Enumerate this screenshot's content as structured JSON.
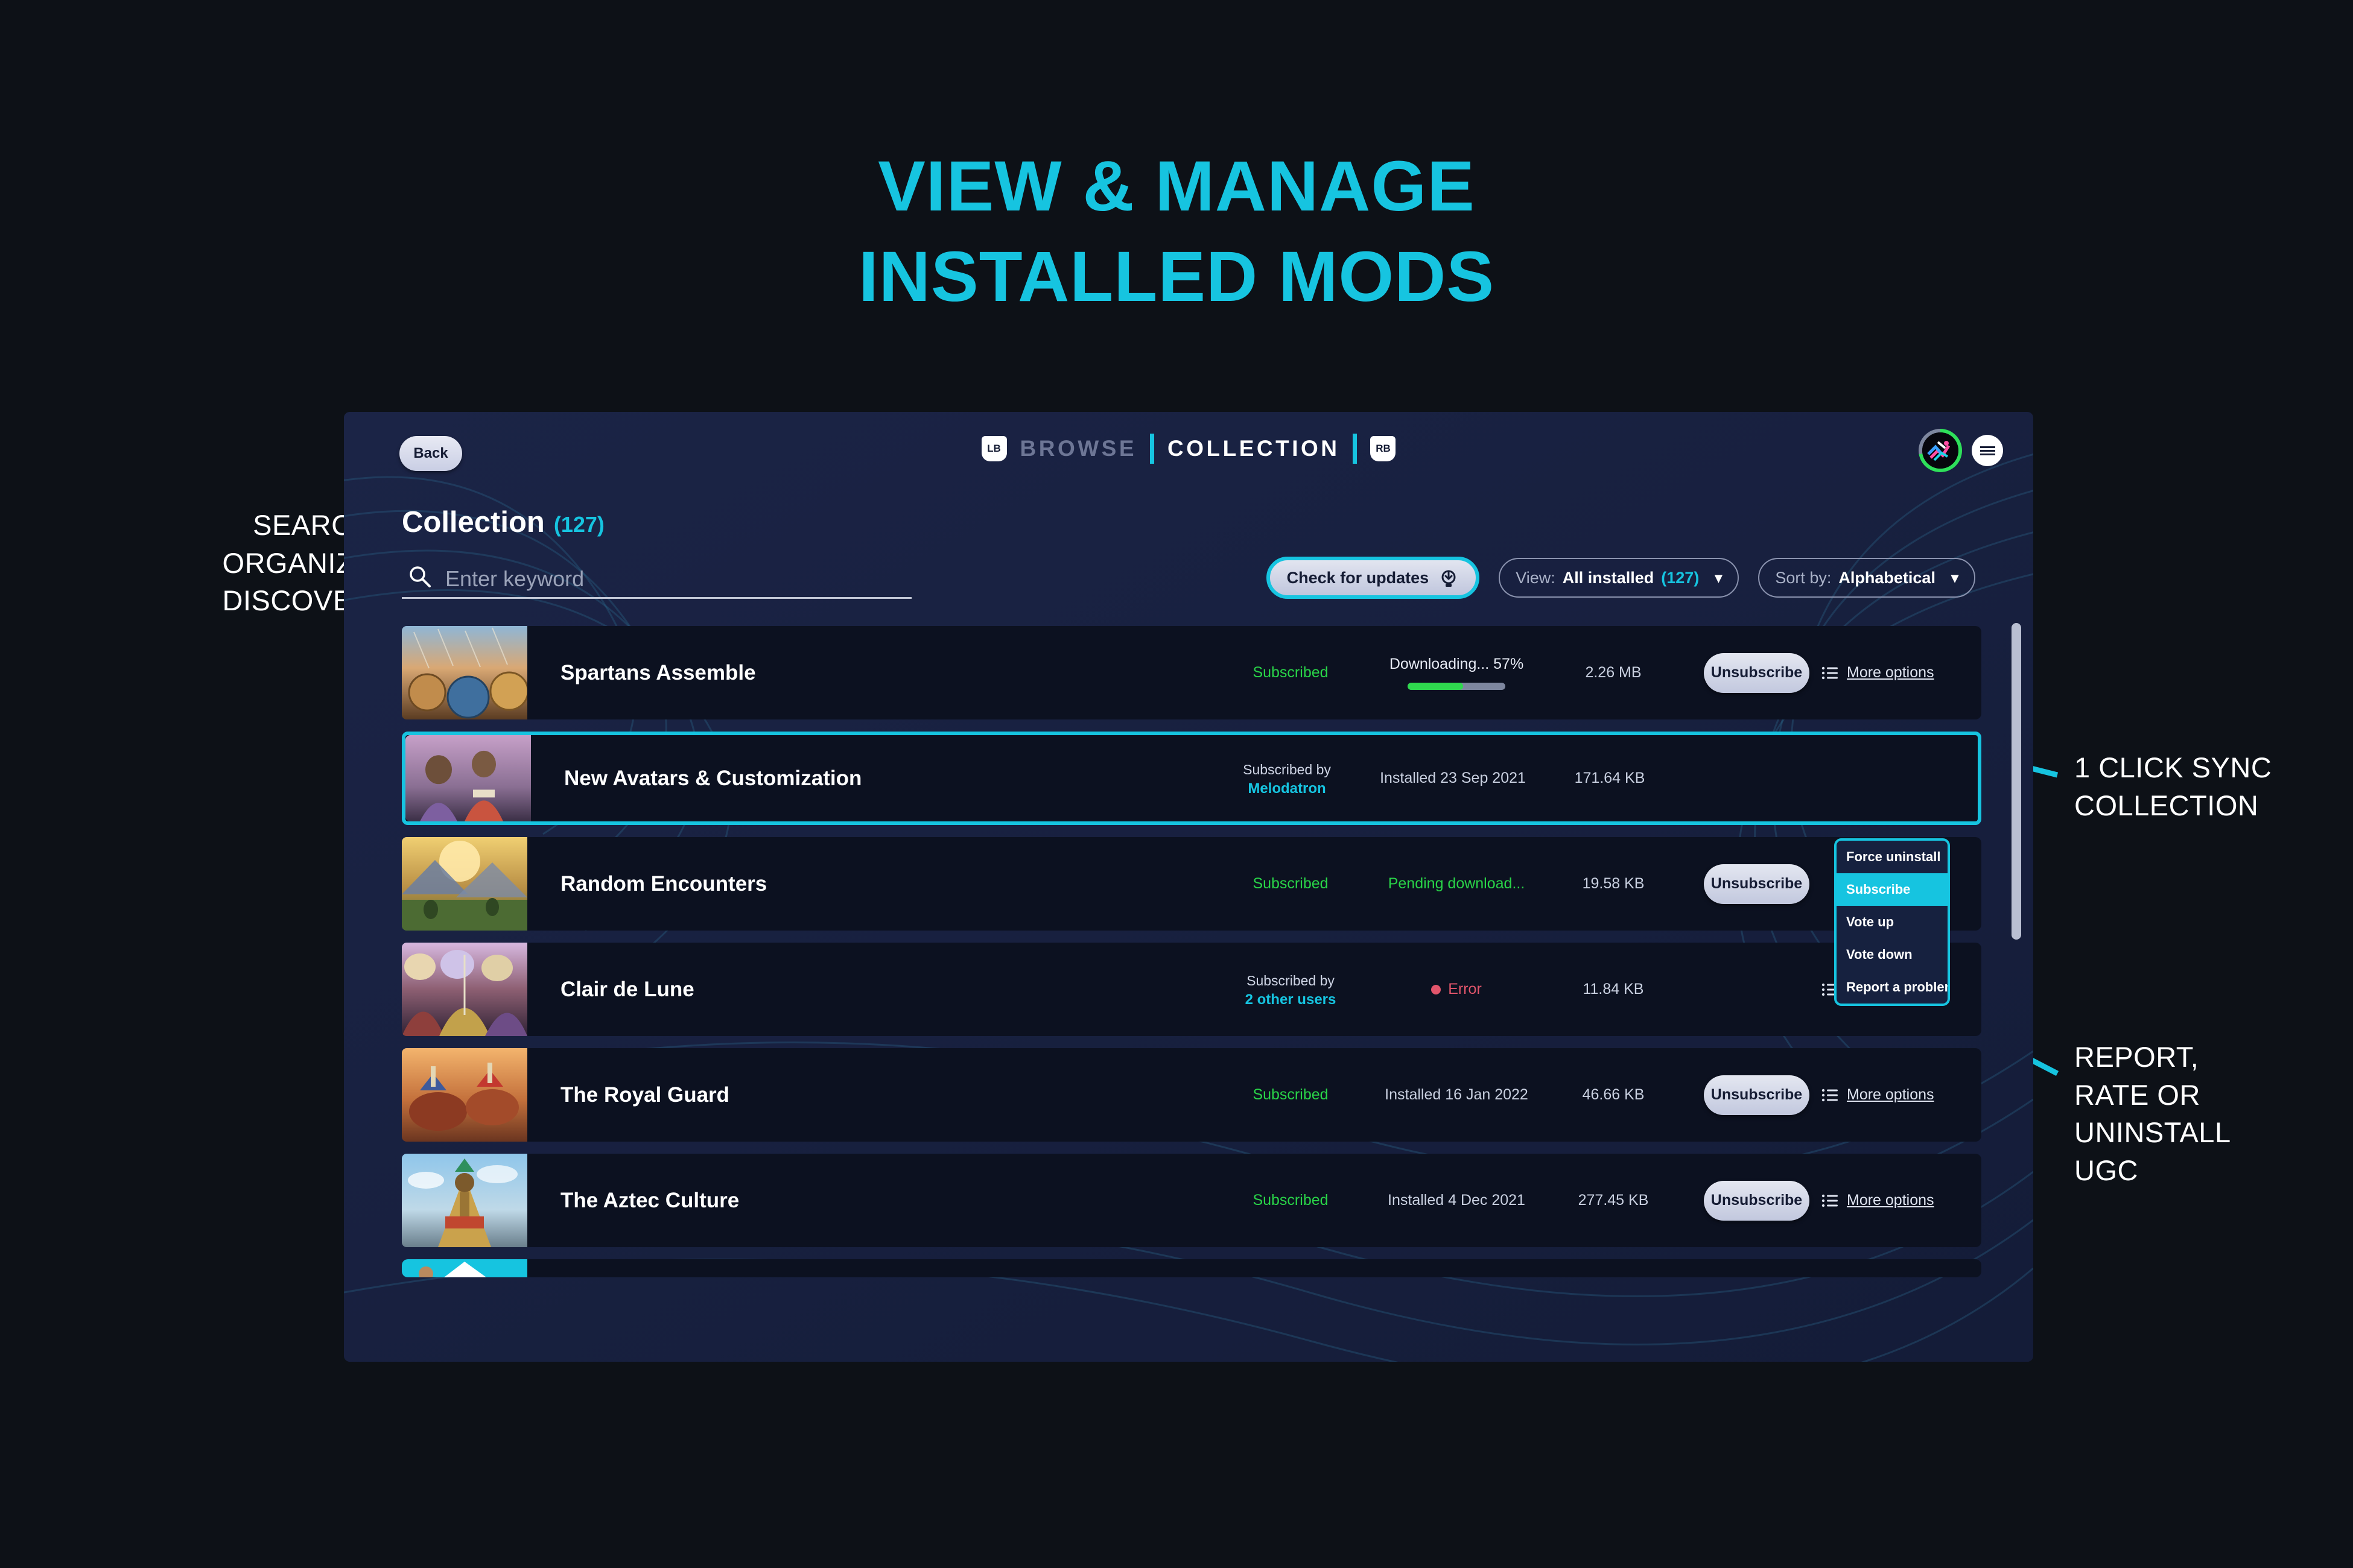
{
  "headline": {
    "line1": "VIEW & MANAGE",
    "line2": "INSTALLED MODS",
    "color": "#16c4e0"
  },
  "annotations": {
    "left": {
      "line1": "SEARCH",
      "line2": "ORGANIZE",
      "line3": "DISCOVER"
    },
    "sync": {
      "line1": "1 CLICK SYNC",
      "line2": "COLLECTION"
    },
    "report": {
      "line1": "REPORT,",
      "line2": "RATE OR",
      "line3": "UNINSTALL",
      "line4": "UGC"
    }
  },
  "app": {
    "header": {
      "back_label": "Back",
      "left_bumper": "LB",
      "right_bumper": "RB",
      "tab_browse": "BROWSE",
      "tab_collection": "COLLECTION",
      "avatar_icon": "user-avatar-icon",
      "menu_icon": "hamburger-menu-icon"
    },
    "page": {
      "title": "Collection",
      "count": "(127)"
    },
    "search": {
      "placeholder": "Enter keyword",
      "value": "",
      "icon": "search-icon"
    },
    "toolbar": {
      "check_updates_label": "Check for updates",
      "check_updates_icon": "download-sync-icon",
      "view_label": "View:",
      "view_value": "All installed",
      "view_count": "(127)",
      "sort_label": "Sort by:",
      "sort_value": "Alphabetical",
      "chevron": "⌄"
    },
    "rows": [
      {
        "name": "Spartans Assemble",
        "sub_status": "Subscribed",
        "sub_type": "plain",
        "status_text": "Downloading... 57%",
        "status_type": "progress",
        "progress": 57,
        "size": "2.26 MB",
        "action": "Unsubscribe",
        "more": "More options",
        "has_more": true,
        "thumb": "spartans"
      },
      {
        "name": "New Avatars & Customization",
        "sub_status": "Subscribed by",
        "sub_user": "Melodatron",
        "sub_type": "by-user",
        "status_text": "Installed 23 Sep 2021",
        "status_type": "plain",
        "size": "171.64 KB",
        "action": "",
        "more": "",
        "has_more": false,
        "selected": true,
        "thumb": "avatars"
      },
      {
        "name": "Random Encounters",
        "sub_status": "Subscribed",
        "sub_type": "plain",
        "status_text": "Pending download...",
        "status_type": "green",
        "size": "19.58 KB",
        "action": "Unsubscribe",
        "more": "",
        "has_more": false,
        "thumb": "encounters"
      },
      {
        "name": "Clair de Lune",
        "sub_status": "Subscribed by",
        "sub_user": "2 other users",
        "sub_type": "by-user",
        "status_text": "Error",
        "status_type": "error",
        "size": "11.84 KB",
        "action": "",
        "more": "More options",
        "has_more": true,
        "thumb": "clair"
      },
      {
        "name": "The Royal Guard",
        "sub_status": "Subscribed",
        "sub_type": "plain",
        "status_text": "Installed 16 Jan 2022",
        "status_type": "plain",
        "size": "46.66 KB",
        "action": "Unsubscribe",
        "more": "More options",
        "has_more": true,
        "thumb": "royal"
      },
      {
        "name": "The Aztec Culture",
        "sub_status": "Subscribed",
        "sub_type": "plain",
        "status_text": "Installed 4 Dec 2021",
        "status_type": "plain",
        "size": "277.45 KB",
        "action": "Unsubscribe",
        "more": "More options",
        "has_more": true,
        "thumb": "aztec"
      }
    ],
    "context_menu": {
      "items": [
        {
          "label": "Force uninstall",
          "highlighted": false
        },
        {
          "label": "Subscribe",
          "highlighted": true
        },
        {
          "label": "Vote up",
          "highlighted": false
        },
        {
          "label": "Vote down",
          "highlighted": false
        },
        {
          "label": "Report a problem",
          "highlighted": false
        }
      ]
    }
  },
  "colors": {
    "accent": "#16c4e0",
    "success": "#29d448",
    "error": "#e2556b",
    "page_bg": "#0d1117",
    "panel_bg": "#18213f",
    "row_bg": "#0c1120"
  }
}
